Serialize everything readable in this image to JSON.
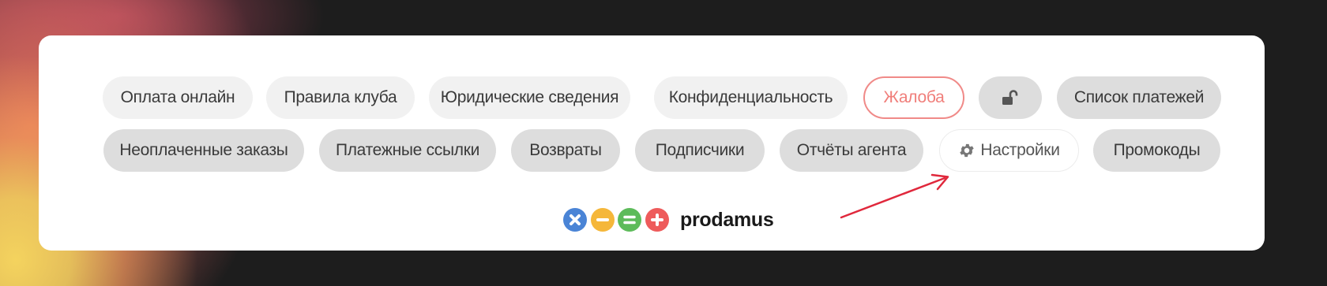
{
  "row1": [
    {
      "label": "Оплата онлайн"
    },
    {
      "label": "Правила клуба"
    },
    {
      "label": "Юридические сведения"
    },
    {
      "label": "Конфиденциальность"
    },
    {
      "label": "Жалоба"
    },
    {
      "label": ""
    },
    {
      "label": "Список платежей"
    }
  ],
  "row2": [
    {
      "label": "Неоплаченные заказы"
    },
    {
      "label": "Платежные ссылки"
    },
    {
      "label": "Возвраты"
    },
    {
      "label": "Подписчики"
    },
    {
      "label": "Отчёты агента"
    },
    {
      "label": "Настройки"
    },
    {
      "label": "Промокоды"
    }
  ],
  "logo": {
    "brand": "prodamus",
    "dot_colors": [
      "#4a84d6",
      "#f5b73a",
      "#5dbb5a",
      "#ee5b5b"
    ]
  },
  "icons": {
    "lock": "lock-open-icon",
    "gear": "gear-icon"
  },
  "colors": {
    "accent_red": "#f08a88",
    "arrow": "#e0283c"
  }
}
